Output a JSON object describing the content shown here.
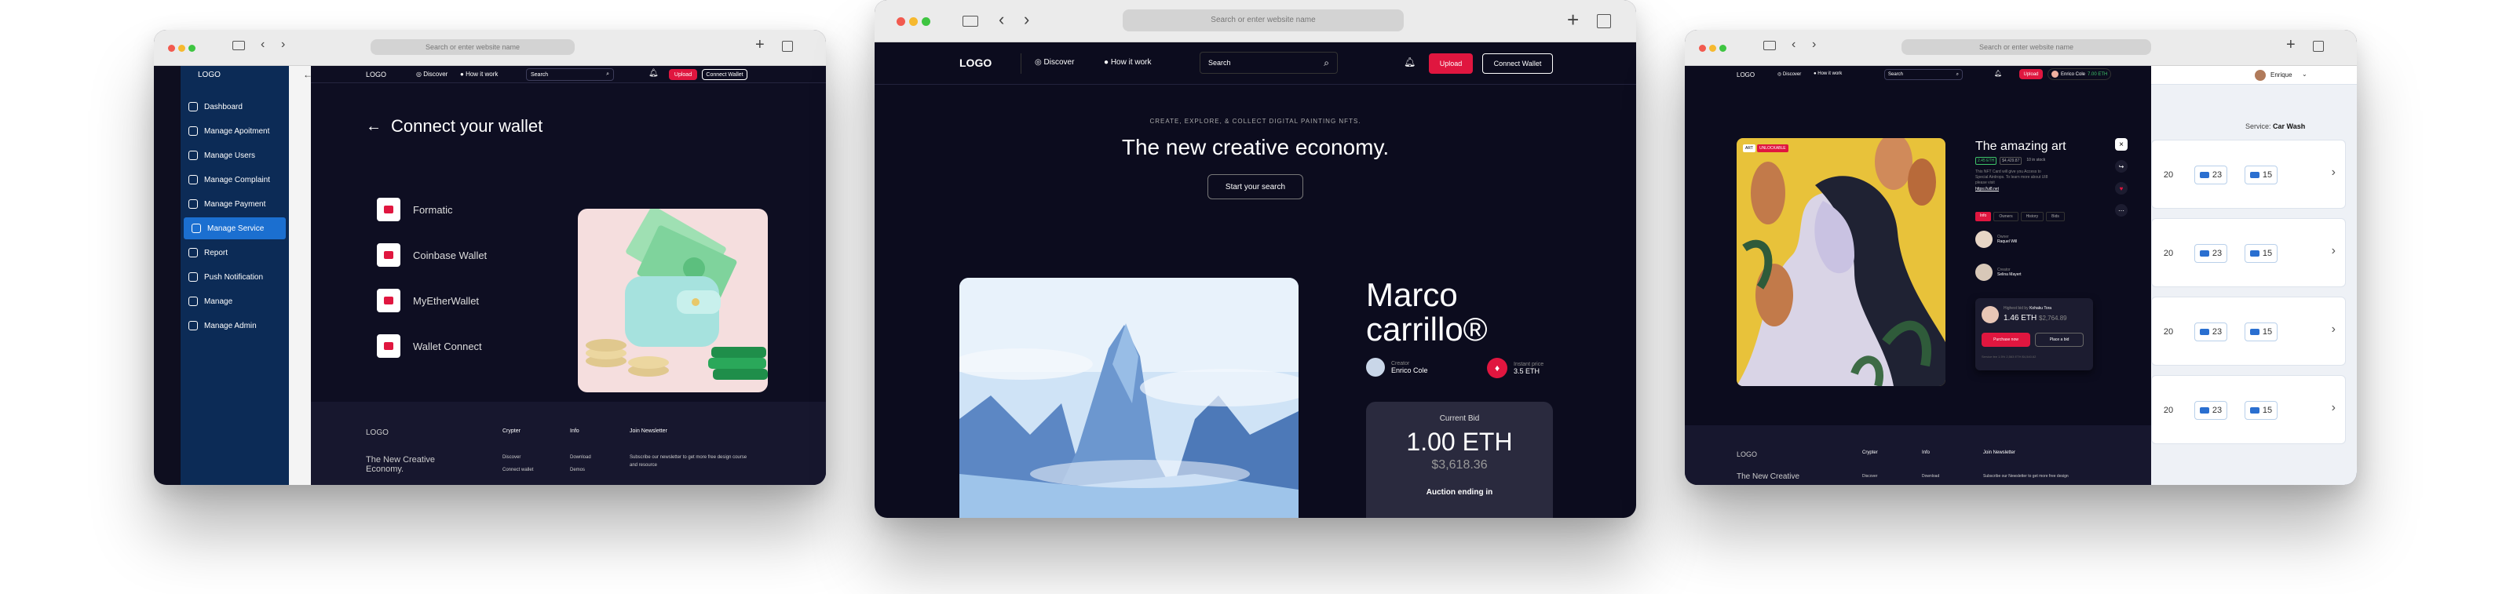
{
  "browser": {
    "url_placeholder": "Search or enter website name"
  },
  "window1": {
    "sidebar": {
      "logo": "LOGO",
      "items": [
        {
          "label": "Dashboard"
        },
        {
          "label": "Manage Apoitment"
        },
        {
          "label": "Manage Users"
        },
        {
          "label": "Manage Complaint"
        },
        {
          "label": "Manage Payment"
        },
        {
          "label": "Manage Service"
        },
        {
          "label": "Report"
        },
        {
          "label": "Push Notification"
        },
        {
          "label": "Manage"
        },
        {
          "label": "Manage Admin"
        }
      ],
      "active": "Manage Service"
    },
    "nav": {
      "logo": "LOGO",
      "discover": "Discover",
      "how": "How it work",
      "search": "Search",
      "upload": "Upload",
      "connect": "Connect Wallet"
    },
    "title": "Connect your wallet",
    "wallets": [
      {
        "label": "Formatic"
      },
      {
        "label": "Coinbase Wallet"
      },
      {
        "label": "MyEtherWallet"
      },
      {
        "label": "Wallet Connect"
      }
    ],
    "footer": {
      "logo": "LOGO",
      "tagline": "The New Creative Economy.",
      "col1": "Crypter",
      "col1_items": [
        "Discover",
        "Connect wallet"
      ],
      "col2": "Info",
      "col2_items": [
        "Download",
        "Demos"
      ],
      "col3": "Join Newsletter",
      "col3_text": "Subscribe our newsletter to get more free design course and resource"
    }
  },
  "window2": {
    "nav": {
      "logo": "LOGO",
      "discover": "Discover",
      "how": "How it work",
      "search": "Search",
      "upload": "Upload",
      "connect": "Connect Wallet"
    },
    "eyebrow": "CREATE, EXPLORE, & COLLECT DIGITAL PAINTING NFTS.",
    "headline": "The new creative economy.",
    "cta": "Start your search",
    "artist": {
      "name": "Marco carrillo®",
      "creator_label": "Creator",
      "creator": "Enrico Cole",
      "instant_label": "Instant price",
      "instant": "3.5 ETH"
    },
    "bid": {
      "label": "Current Bid",
      "eth": "1.00 ETH",
      "usd": "$3,618.36",
      "ending": "Auction ending in"
    }
  },
  "window3": {
    "nav": {
      "logo": "LOGO",
      "discover": "Discover",
      "how": "How it work",
      "search": "Search",
      "upload": "Upload",
      "user": "Enrico Cole",
      "balance": "7.00 ETH"
    },
    "user_menu": "Enrique",
    "art": {
      "badge1": "ART",
      "badge2": "UNLOCKABLE",
      "title": "The amazing art",
      "price_eth": "2.45 ETH",
      "price_usd": "$4,429.87",
      "stock": "10 in stock",
      "desc": "This NFT Card will give you Access to Special Airdrops. To learn more about UI8 please visit",
      "link": "https://ui8.net",
      "tabs": [
        "Info",
        "Owners",
        "History",
        "Bids"
      ],
      "people": [
        {
          "role": "Owner",
          "name": "Raquel Will"
        },
        {
          "role": "Creator",
          "name": "Selina Mayert"
        }
      ],
      "bid_label": "Highest bid by",
      "bidder": "Kohaku Tora",
      "bid_eth": "1.46 ETH",
      "bid_usd": "$2,764.89",
      "purchase": "Purchase now",
      "place": "Place a bid",
      "fee": "Service fee 1.5% 2,563 ETH $4,540.62"
    },
    "footer": {
      "logo": "LOGO",
      "tagline": "The New Creative",
      "col1": "Crypter",
      "col1_items": [
        "Discover"
      ],
      "col2": "Info",
      "col2_items": [
        "Download"
      ],
      "col3": "Join Newsletter",
      "col3_text": "Subscribe our Newsletter to get more free design"
    },
    "panel": {
      "service_label": "Service:",
      "service_value": "Car Wash",
      "rows": [
        {
          "a": "20",
          "b": "23",
          "c": "15"
        },
        {
          "a": "20",
          "b": "23",
          "c": "15"
        },
        {
          "a": "20",
          "b": "23",
          "c": "15"
        },
        {
          "a": "20",
          "b": "23",
          "c": "15"
        }
      ]
    }
  }
}
